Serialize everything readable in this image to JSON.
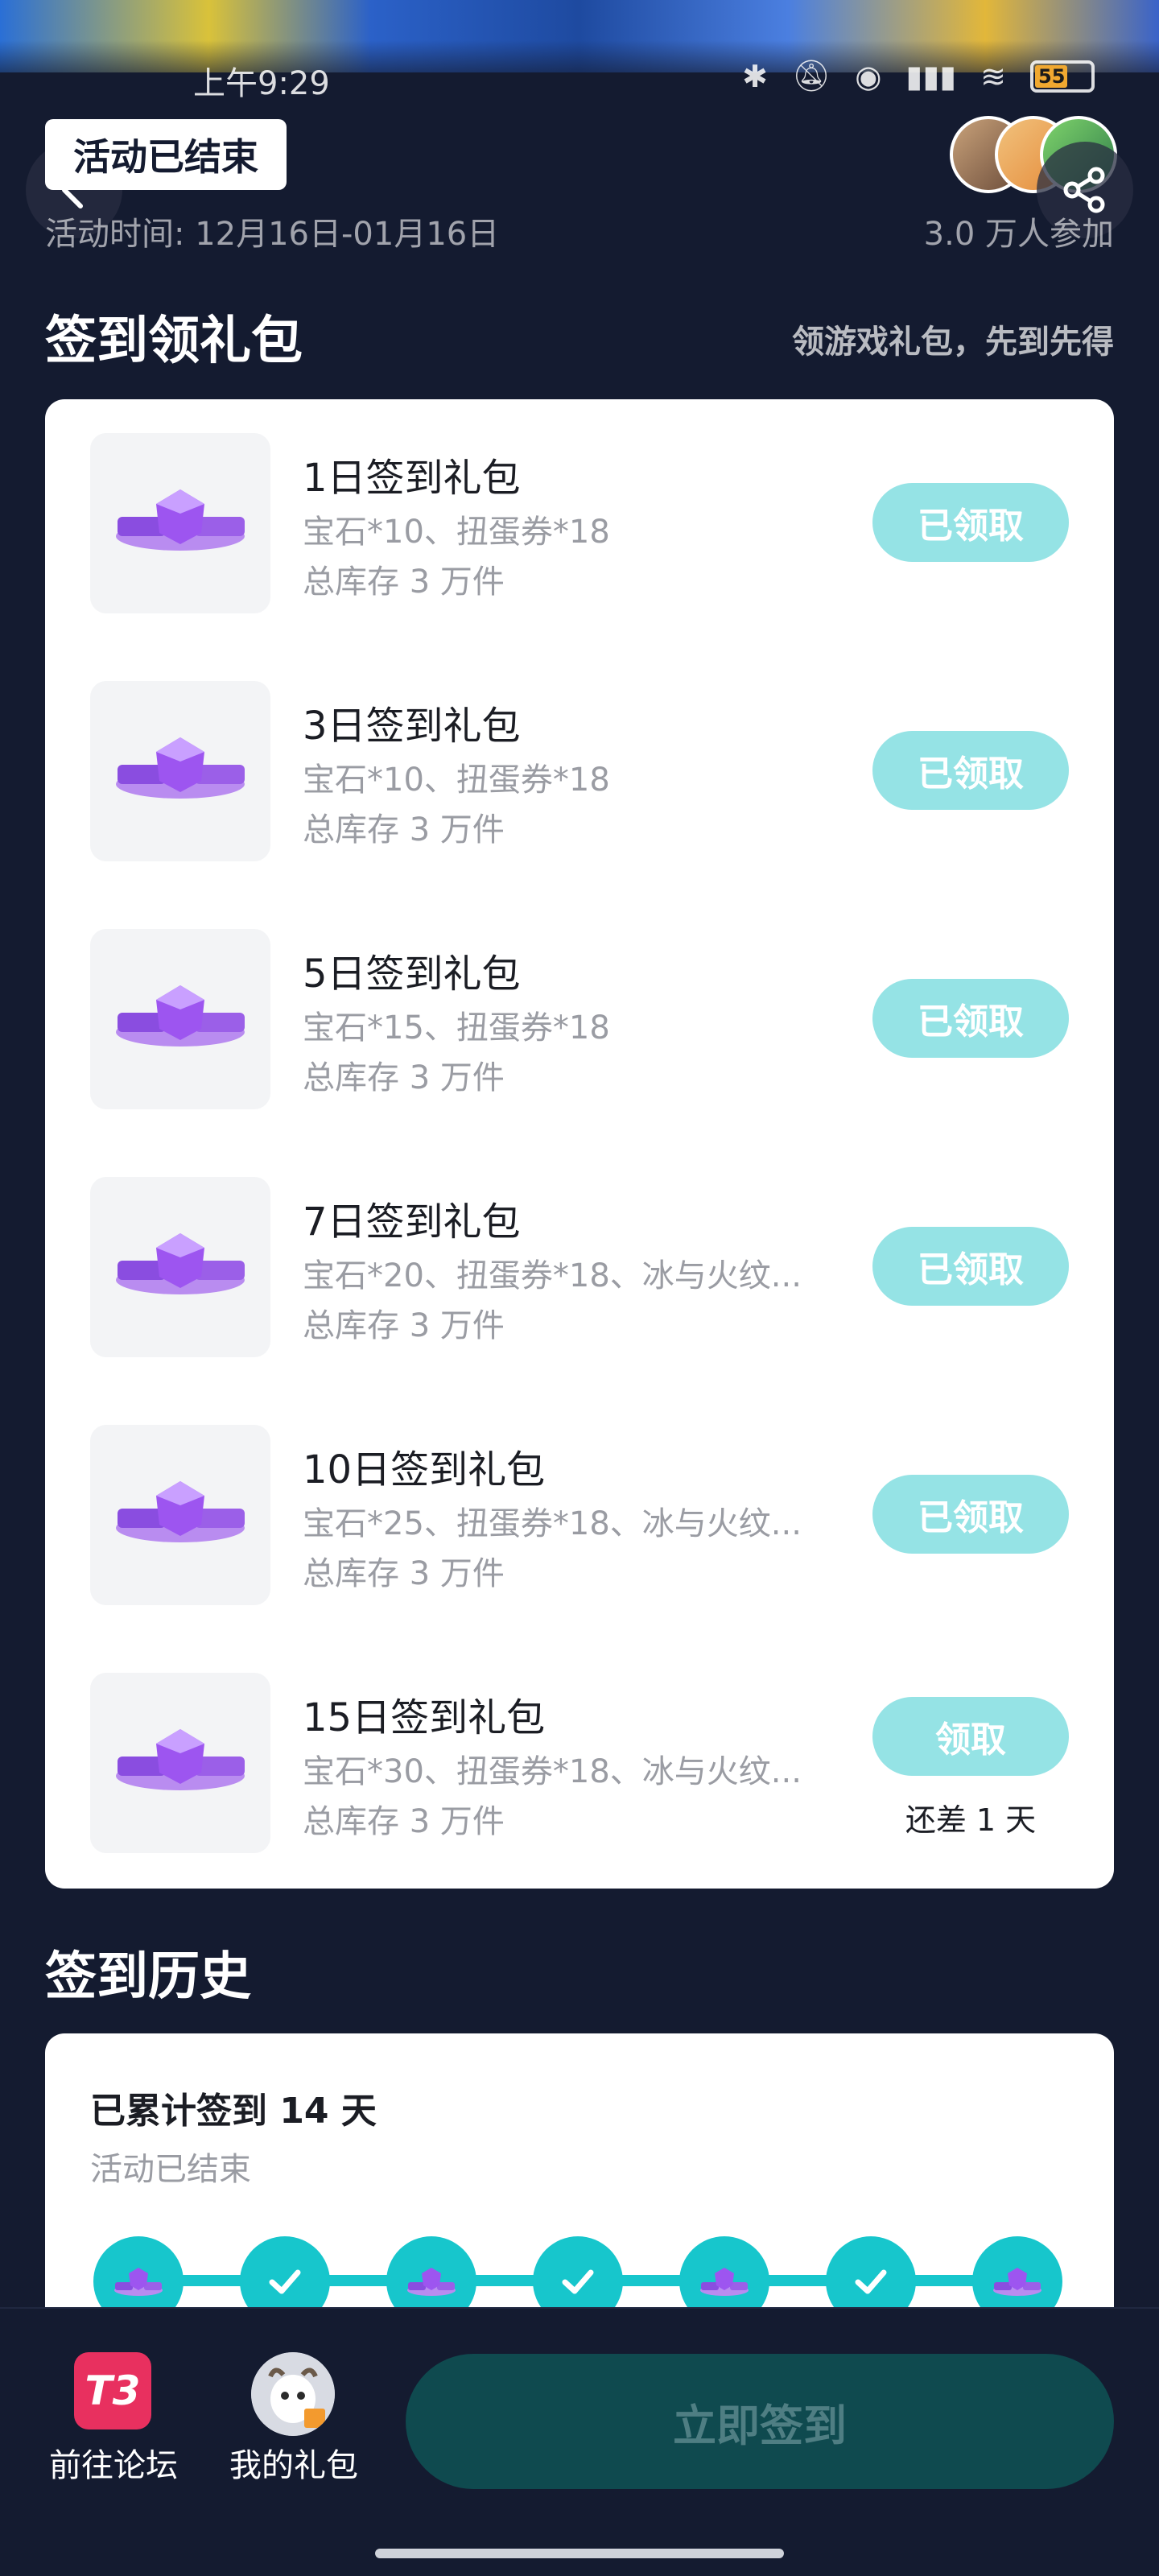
{
  "status_bar": {
    "time": "上午9:29",
    "battery": "55",
    "battery_level": 0.55
  },
  "header": {
    "badge": "活动已结束",
    "activity_time": "活动时间: 12月16日-01月16日",
    "participants": "3.0 万人参加"
  },
  "gift_section": {
    "title": "签到领礼包",
    "subtitle": "领游戏礼包，先到先得",
    "items": [
      {
        "name": "1日签到礼包",
        "contents": "宝石*10、扭蛋券*18",
        "stock": "总库存 3 万件",
        "button": "已领取"
      },
      {
        "name": "3日签到礼包",
        "contents": "宝石*10、扭蛋券*18",
        "stock": "总库存 3 万件",
        "button": "已领取"
      },
      {
        "name": "5日签到礼包",
        "contents": "宝石*15、扭蛋券*18",
        "stock": "总库存 3 万件",
        "button": "已领取"
      },
      {
        "name": "7日签到礼包",
        "contents": "宝石*20、扭蛋券*18、冰与火纹...",
        "stock": "总库存 3 万件",
        "button": "已领取"
      },
      {
        "name": "10日签到礼包",
        "contents": "宝石*25、扭蛋券*18、冰与火纹...",
        "stock": "总库存 3 万件",
        "button": "已领取"
      },
      {
        "name": "15日签到礼包",
        "contents": "宝石*30、扭蛋券*18、冰与火纹...",
        "stock": "总库存 3 万件",
        "button": "领取",
        "note": "还差 1 天"
      }
    ]
  },
  "history": {
    "title": "签到历史",
    "total": "已累计签到 14 天",
    "status": "活动已结束",
    "nodes": [
      "gift-icon",
      "check-icon",
      "gift-icon",
      "check-icon",
      "gift-icon",
      "check-icon",
      "gift-icon"
    ]
  },
  "bottom_bar": {
    "forum_icon_text": "T3",
    "forum_label": "前往论坛",
    "mygift_label": "我的礼包",
    "checkin_button": "立即签到"
  },
  "colors": {
    "background": "#141b30",
    "accent": "#17c6cc",
    "claimed_button": "#95e3e5",
    "checkin_disabled": "#0f4a4f",
    "forum_icon": "#e8305f"
  }
}
